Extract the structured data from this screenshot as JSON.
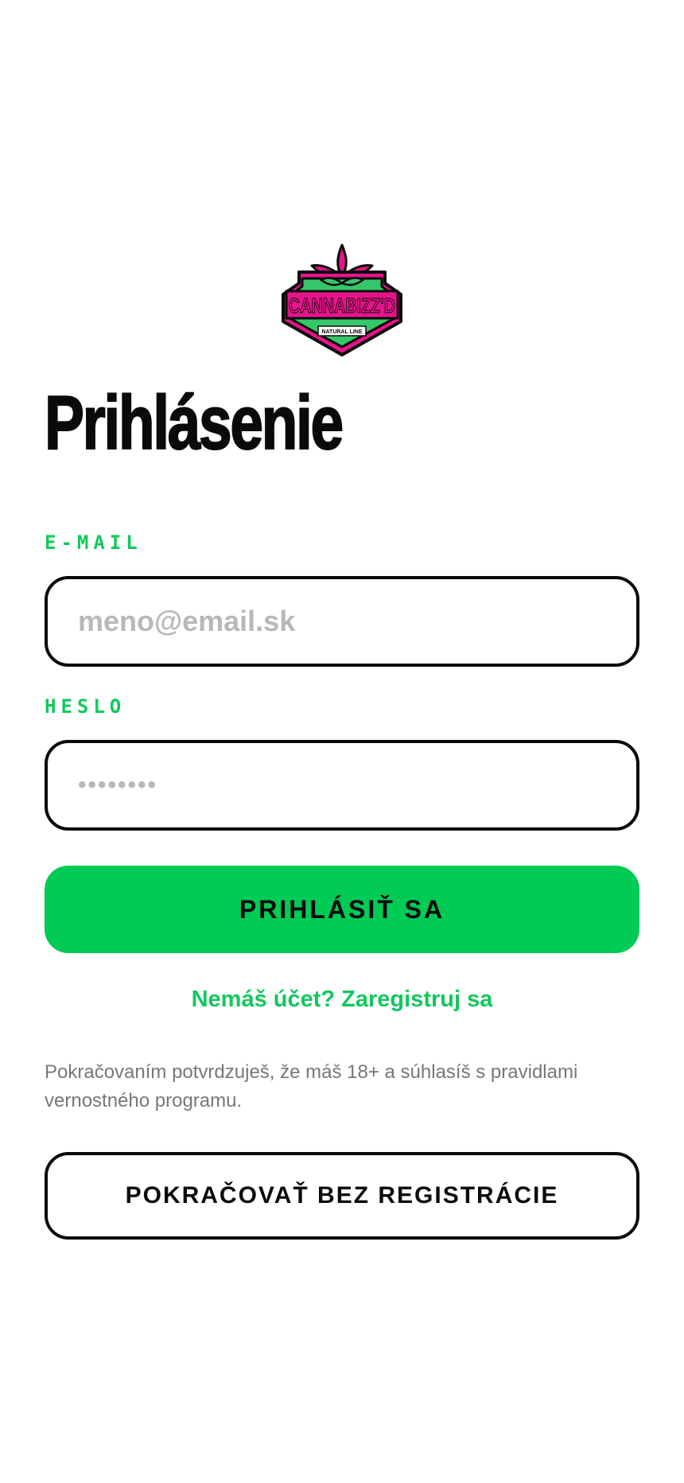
{
  "logo": {
    "brand": "CANNABIZZ'D",
    "tagline": "NATURAL LINE",
    "colors": {
      "green": "#35c76a",
      "pink": "#e6148a",
      "black": "#0a0a0a"
    }
  },
  "page": {
    "title": "Prihlásenie"
  },
  "form": {
    "email_label": "E-MAIL",
    "email_placeholder": "meno@email.sk",
    "password_label": "HESLO",
    "password_placeholder": "••••••••",
    "submit_label": "PRIHLÁSIŤ SA"
  },
  "register": {
    "link_text": "Nemáš účet? Zaregistruj sa"
  },
  "disclaimer": {
    "text": "Pokračovaním potvrdzuješ, že máš 18+ a súhlasíš s pravidlami vernostného programu."
  },
  "guest": {
    "button_label": "POKRAČOVAŤ BEZ REGISTRÁCIE"
  },
  "colors": {
    "accent": "#00cb55",
    "text": "#0a0a0a",
    "muted": "#777777",
    "placeholder": "#b8b8b8"
  }
}
